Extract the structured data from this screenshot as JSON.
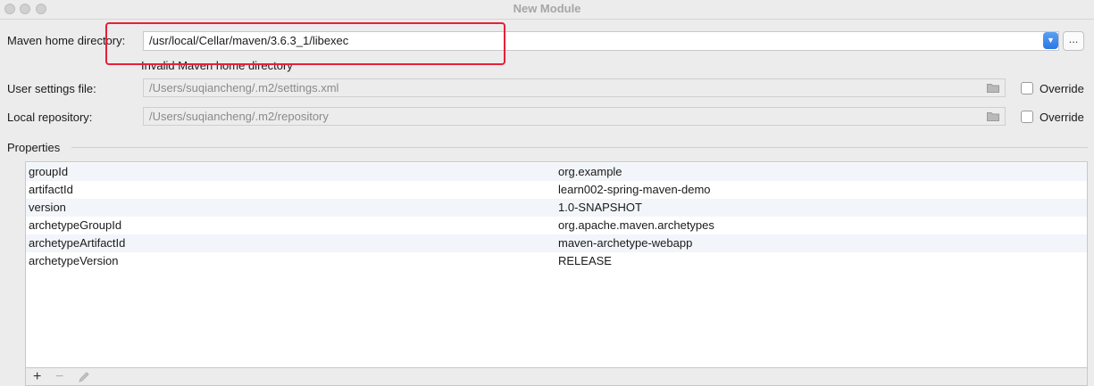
{
  "window": {
    "title": "New Module"
  },
  "maven_home": {
    "label": "Maven home directory:",
    "value": "/usr/local/Cellar/maven/3.6.3_1/libexec",
    "error": "Invalid Maven home directory",
    "browse_label": "..."
  },
  "user_settings": {
    "label": "User settings file:",
    "value": "/Users/suqiancheng/.m2/settings.xml",
    "override_label": "Override"
  },
  "local_repo": {
    "label": "Local repository:",
    "value": "/Users/suqiancheng/.m2/repository",
    "override_label": "Override"
  },
  "properties": {
    "title": "Properties",
    "rows": [
      {
        "key": "groupId",
        "value": "org.example"
      },
      {
        "key": "artifactId",
        "value": "learn002-spring-maven-demo"
      },
      {
        "key": "version",
        "value": "1.0-SNAPSHOT"
      },
      {
        "key": "archetypeGroupId",
        "value": "org.apache.maven.archetypes"
      },
      {
        "key": "archetypeArtifactId",
        "value": "maven-archetype-webapp"
      },
      {
        "key": "archetypeVersion",
        "value": "RELEASE"
      }
    ]
  },
  "toolbar": {
    "add_icon": "+",
    "remove_icon": "−",
    "edit_icon": "pencil-icon"
  },
  "colors": {
    "highlight": "#e5203a",
    "accent": "#2a77e6"
  }
}
